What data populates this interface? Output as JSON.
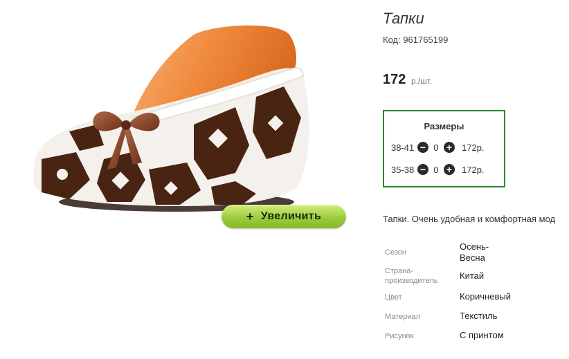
{
  "product": {
    "title": "Тапки",
    "code": "Код: 961765199",
    "price": "172",
    "price_unit": "р./шт.",
    "zoom_button": "Увеличить",
    "zoom_plus": "+",
    "description": "Тапки. Очень удобная и комфортная мод"
  },
  "sizes": {
    "title": "Размеры",
    "rows": [
      {
        "size": "38-41",
        "qty": "0",
        "price": "172р."
      },
      {
        "size": "35-38",
        "qty": "0",
        "price": "172р."
      }
    ]
  },
  "attributes": [
    {
      "label": "Сезон",
      "value": "Осень-Весна"
    },
    {
      "label": "Страна-производитель",
      "value": "Китай"
    },
    {
      "label": "Цвет",
      "value": "Коричневый"
    },
    {
      "label": "Материал",
      "value": "Текстиль"
    },
    {
      "label": "Рисунок",
      "value": "С принтом"
    }
  ],
  "colors": {
    "zoom_button": "#9ccc3d",
    "sizes_border": "#2a8a2a",
    "slipper_brown": "#4a2412",
    "last_orange": "#f08a3c"
  }
}
